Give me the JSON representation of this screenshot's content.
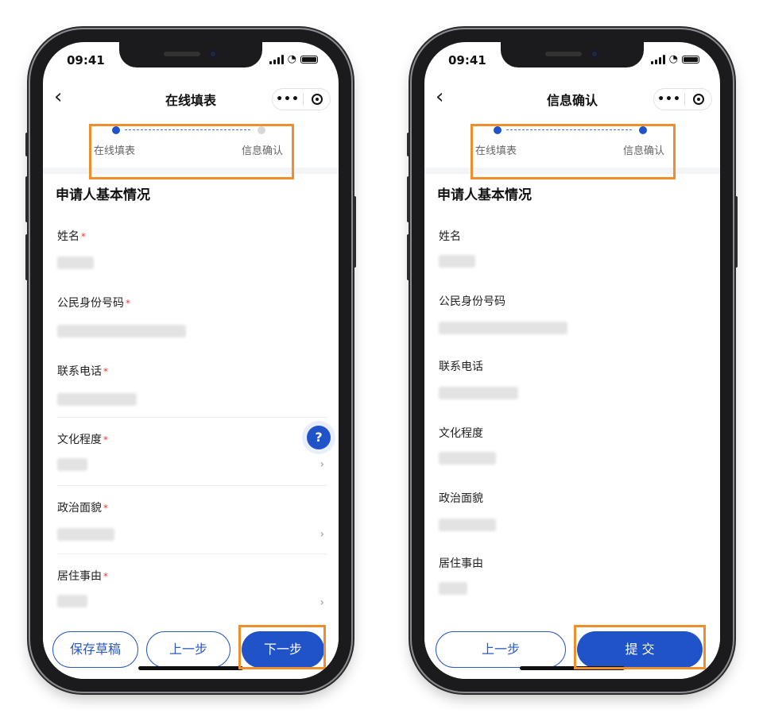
{
  "colors": {
    "accent": "#2052c8",
    "highlight": "#ef8e2a",
    "required": "#e53935"
  },
  "left_phone": {
    "status_time": "09:41",
    "nav_title": "在线填表",
    "capsule_more": "•••",
    "steps": [
      "在线填表",
      "信息确认"
    ],
    "section_title": "申请人基本情况",
    "fields": [
      {
        "label": "姓名",
        "required": "*"
      },
      {
        "label": "公民身份号码",
        "required": "*"
      },
      {
        "label": "联系电话",
        "required": "*"
      },
      {
        "label": "文化程度",
        "required": "*"
      },
      {
        "label": "政治面貌",
        "required": "*"
      },
      {
        "label": "居住事由",
        "required": "*"
      }
    ],
    "help_label": "?",
    "buttons": {
      "save_draft": "保存草稿",
      "prev": "上一步",
      "next": "下一步"
    }
  },
  "right_phone": {
    "status_time": "09:41",
    "nav_title": "信息确认",
    "capsule_more": "•••",
    "steps": [
      "在线填表",
      "信息确认"
    ],
    "section_title": "申请人基本情况",
    "fields": [
      {
        "label": "姓名"
      },
      {
        "label": "公民身份号码"
      },
      {
        "label": "联系电话"
      },
      {
        "label": "文化程度"
      },
      {
        "label": "政治面貌"
      },
      {
        "label": "居住事由"
      }
    ],
    "buttons": {
      "prev": "上一步",
      "submit": "提 交"
    }
  }
}
